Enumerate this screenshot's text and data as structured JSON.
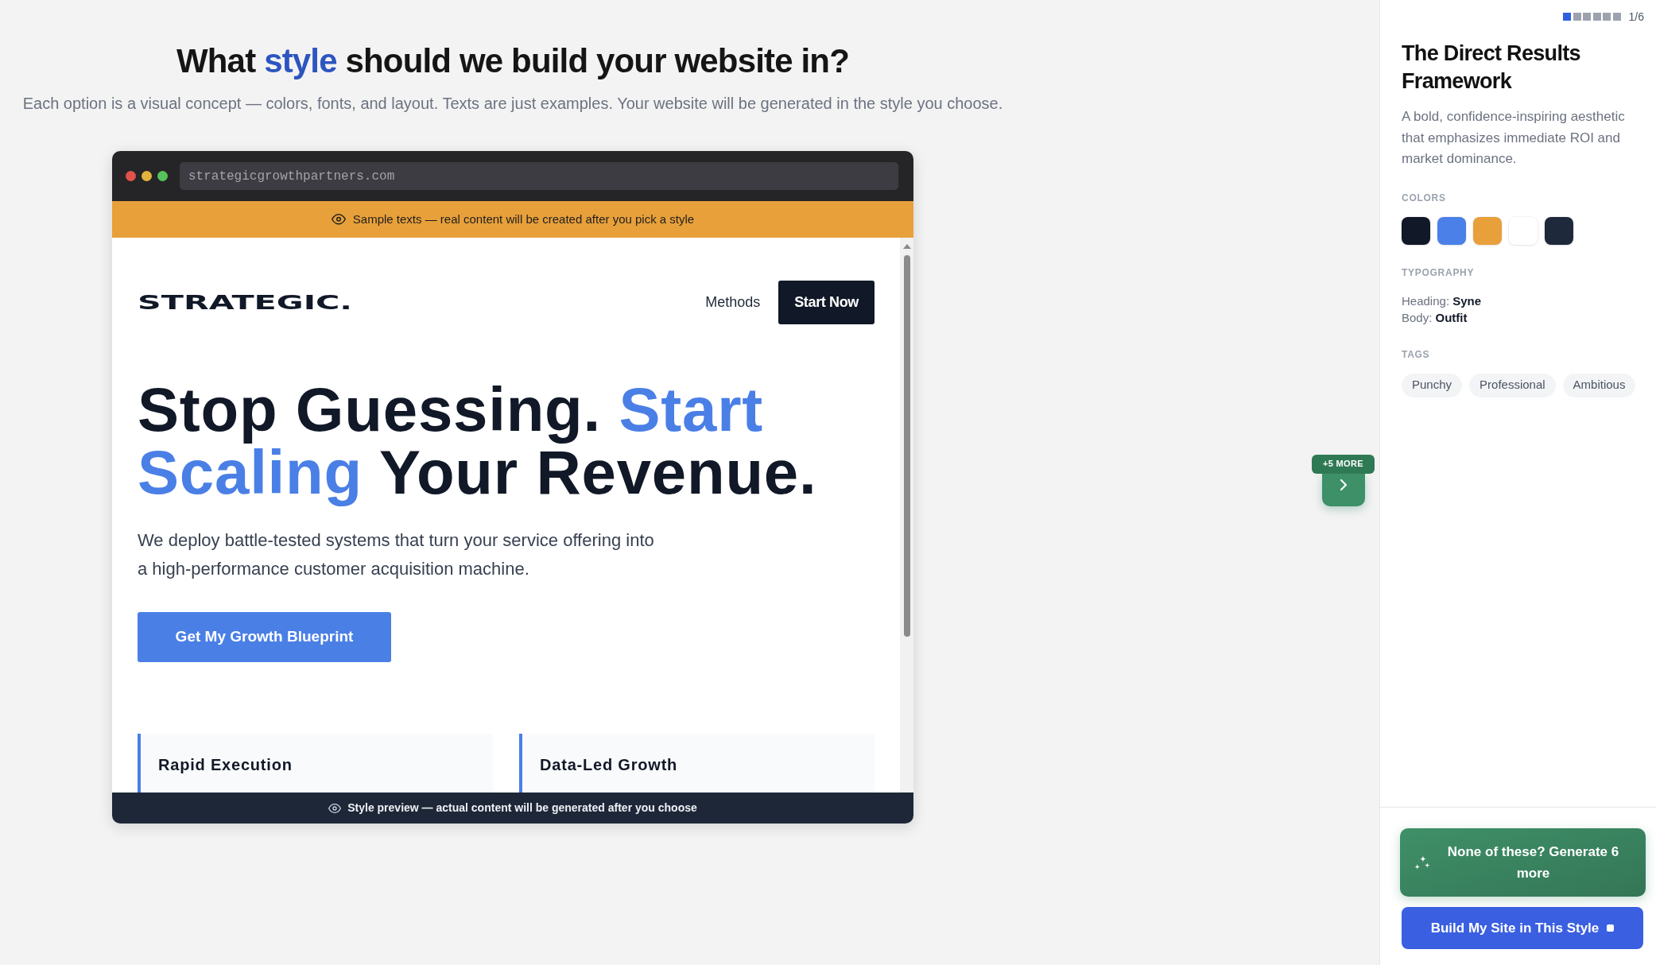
{
  "header": {
    "title": [
      {
        "text": "What ",
        "accent": false
      },
      {
        "text": "style",
        "accent": true
      },
      {
        "text": " should we build your website in?",
        "accent": false
      }
    ],
    "subtitle": "Each option is a visual concept — colors, fonts, and layout. Texts are just examples. Your website will be generated in the style you choose."
  },
  "preview": {
    "address": "strategicgrowthpartners.com",
    "notice": "Sample texts — real content will be created after you pick a style",
    "site": {
      "logo": "STRATEGIC.",
      "nav_links": [
        "Methods"
      ],
      "nav_button": "Start Now",
      "headline": [
        {
          "text": "Stop Guessing. ",
          "accent": false
        },
        {
          "text": "Start Scaling",
          "accent": true
        },
        {
          "text": " Your Revenue.",
          "accent": false
        }
      ],
      "paragraph": "We deploy battle-tested systems that turn your service offering into a high-performance customer acquisition machine.",
      "cta_button": "Get My Growth Blueprint",
      "cards": [
        {
          "title": "Rapid Execution"
        },
        {
          "title": "Data-Led Growth"
        }
      ]
    },
    "footer": "Style preview — actual content will be generated after you choose"
  },
  "next_button": {
    "badge": "+5 MORE"
  },
  "style_panel": {
    "pager": {
      "steps": [
        {
          "selected": true
        },
        {
          "selected": false
        },
        {
          "selected": false
        },
        {
          "selected": false
        },
        {
          "selected": false
        },
        {
          "selected": false
        }
      ],
      "counter": "1/6"
    },
    "title": "The Direct Results Framework",
    "description": "A bold, confidence-inspiring aesthetic that emphasizes immediate ROI and market dominance.",
    "colors_label": "COLORS",
    "colors": [
      {
        "color": "#111827"
      },
      {
        "color": "#4a80e8"
      },
      {
        "color": "#e8a03a"
      },
      {
        "color": "#ffffff"
      },
      {
        "color": "#1e293b"
      }
    ],
    "typography_label": "TYPOGRAPHY",
    "typography": [
      {
        "label": "Heading:",
        "value": "Syne"
      },
      {
        "label": "Body:",
        "value": "Outfit"
      }
    ],
    "tags_label": "TAGS",
    "tags": [
      "Punchy",
      "Professional",
      "Ambitious"
    ],
    "generate_button": "None of these? Generate 6 more",
    "build_button": "Build My Site in This Style"
  }
}
